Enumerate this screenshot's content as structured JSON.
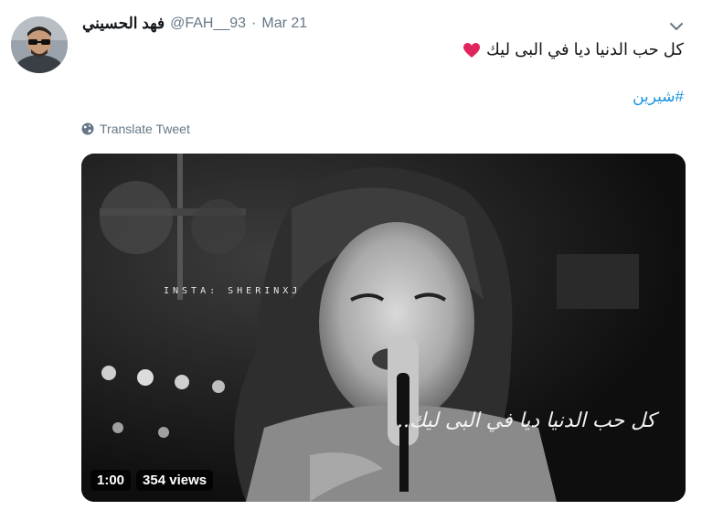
{
  "user": {
    "display_name": "فهد الحسيني",
    "handle": "@FAH__93",
    "separator": "·",
    "date": "Mar 21"
  },
  "tweet": {
    "text": "كل حب الدنيا ديا في البى ليك",
    "hashtag": "#شيرين",
    "translate_label": "Translate Tweet"
  },
  "media": {
    "watermark": "INSTA: SHERINXJ",
    "lyric_overlay": "كل حب الدنيا ديا في البى ليك..",
    "duration": "1:00",
    "views": "354 views"
  },
  "icons": {
    "caret": "chevron-down-icon",
    "heart": "heart-icon",
    "translate": "globe-icon"
  },
  "colors": {
    "link": "#1b95e0",
    "secondary_text": "#657786",
    "heart": "#e0245e"
  }
}
